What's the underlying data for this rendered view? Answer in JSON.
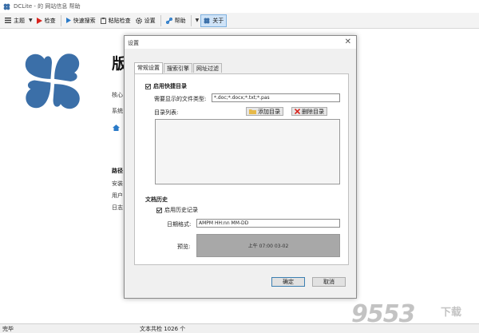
{
  "window": {
    "title": "DCLite - 的 网站信息 帮助"
  },
  "toolbar": {
    "home_label": "主题",
    "check_label": "检查",
    "quick_check_label": "快速搜索",
    "paste_check_label": "粘贴检查",
    "settings_label": "设置",
    "help_label": "帮助",
    "about_label": "关于"
  },
  "main": {
    "heading": "版",
    "line1": "核心",
    "line2": "系统",
    "section_title": "路径",
    "items": [
      "安装",
      "用户",
      "日志"
    ]
  },
  "dialog": {
    "title": "设置",
    "close_glyph": "✕",
    "tabs": [
      "常规设置",
      "搜索引擎",
      "网址过滤"
    ],
    "enable_quick_dir_label": "启用快捷目录",
    "file_types_label": "需要显示的文件类型:",
    "file_types_value": "*.doc;*.docx;*.txt;*.pas",
    "dir_list_label": "目录列表:",
    "add_dir_label": "添加目录",
    "remove_dir_label": "删除目录",
    "doc_history_title": "文档历史",
    "enable_history_label": "启用历史记录",
    "date_format_label": "日期格式:",
    "date_format_value": "AMPM HH:nn MM-DD",
    "preview_label": "预览:",
    "preview_value": "上午 07:00 03-02",
    "ok_label": "确定",
    "cancel_label": "取消"
  },
  "statusbar": {
    "left": "完毕",
    "mid": "文本共检 1026 个"
  },
  "watermark": {
    "text": "9553",
    "sub": "下载"
  },
  "colors": {
    "logo_blue": "#3b6fa8",
    "accent_red": "#d9231d",
    "toolbar_bg": "#f3f3f3",
    "dialog_bg": "#f0f0f0"
  }
}
